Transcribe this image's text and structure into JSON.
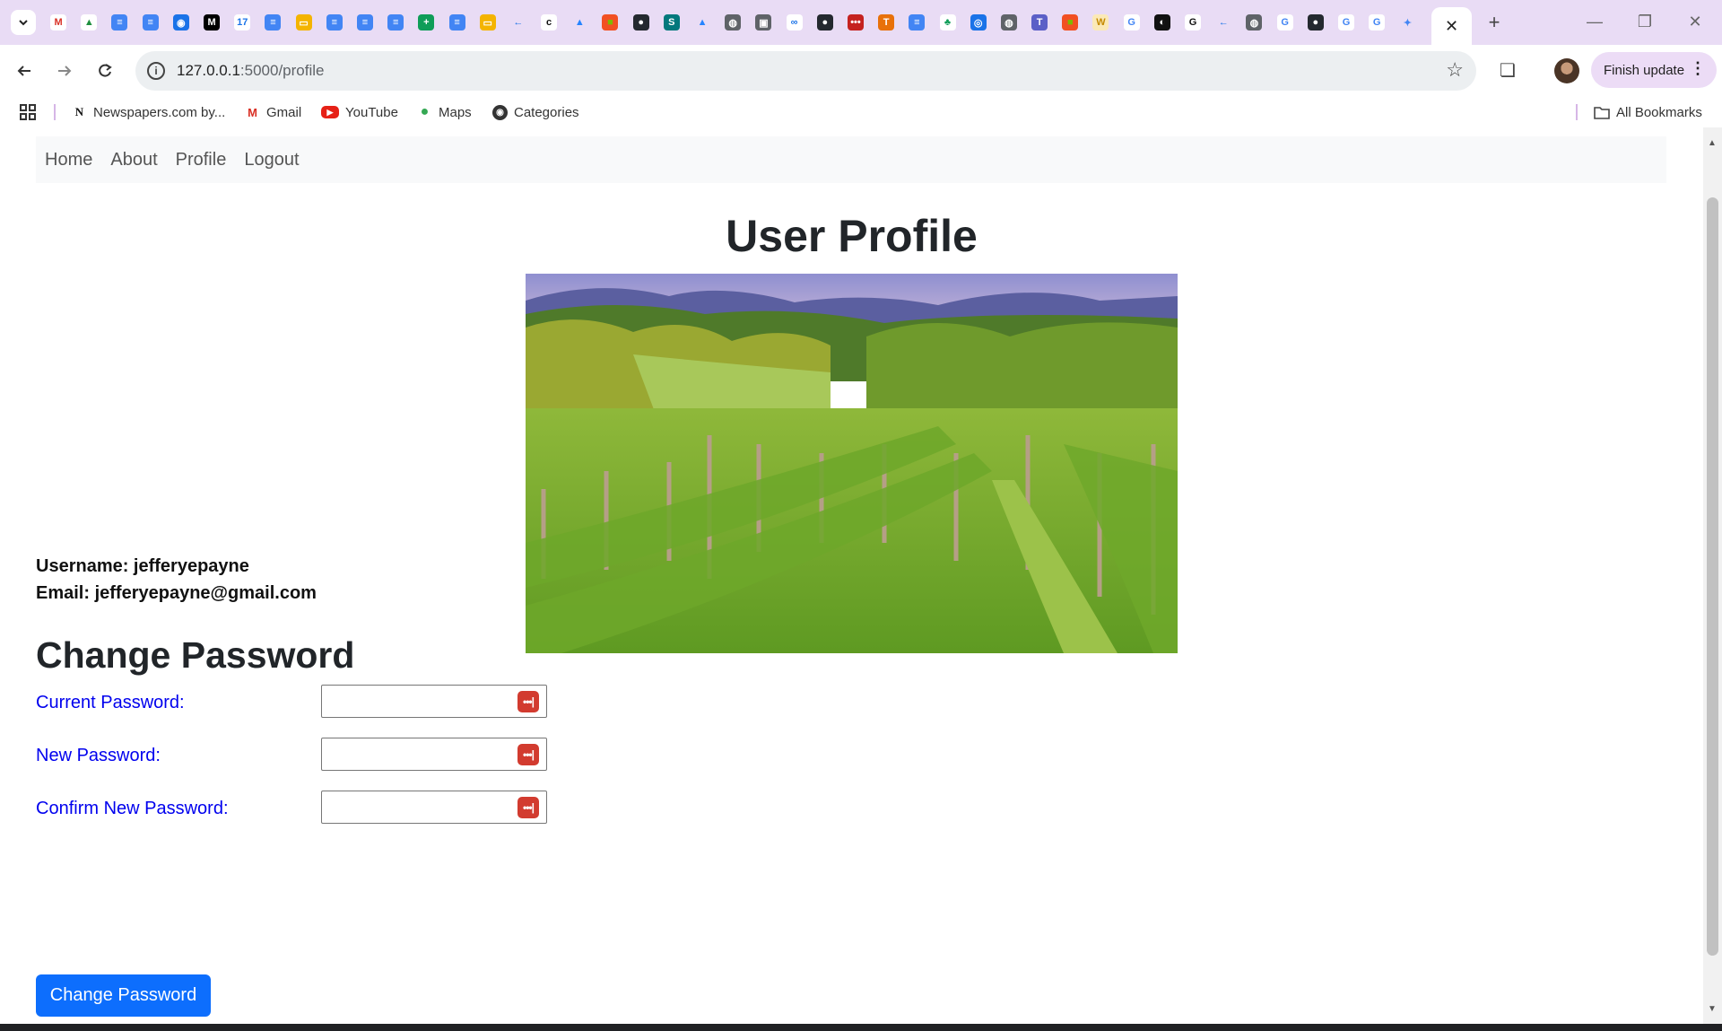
{
  "browser": {
    "tabs_icons": [
      "gmail-icon",
      "drive-icon",
      "docs-icon",
      "docs-icon",
      "chat-icon",
      "medium-icon",
      "calendar-icon",
      "docs-icon",
      "slides-icon",
      "docs-icon",
      "docs-icon",
      "docs-icon",
      "sheets-icon",
      "docs-icon",
      "slides-icon",
      "arrow-icon",
      "c-icon",
      "atlassian-icon",
      "microsoft-icon",
      "github-icon",
      "sharepoint-icon",
      "atlassian-icon",
      "globe-icon",
      "media-icon",
      "dots-icon",
      "github-icon",
      "red-icon",
      "t-icon",
      "docs-icon",
      "tree-icon",
      "eye-icon",
      "globe-icon",
      "teams-icon",
      "microsoft-icon",
      "w-icon",
      "google-icon",
      "flag-icon",
      "g-icon",
      "arrow-icon",
      "globe-icon",
      "google-icon",
      "github-icon",
      "google-icon",
      "google-icon",
      "gemini-icon"
    ],
    "active_tab_close": "✕",
    "new_tab": "+",
    "url_host": "127.0.0.1",
    "url_path": ":5000/profile",
    "finish_update": "Finish update"
  },
  "bookmarks": [
    {
      "label": "Newspapers.com by...",
      "icon": "newspapers-icon"
    },
    {
      "label": "Gmail",
      "icon": "gmail-icon"
    },
    {
      "label": "YouTube",
      "icon": "youtube-icon"
    },
    {
      "label": "Maps",
      "icon": "maps-icon"
    },
    {
      "label": "Categories",
      "icon": "globe-icon"
    }
  ],
  "all_bookmarks": "All Bookmarks",
  "nav": {
    "home": "Home",
    "about": "About",
    "profile": "Profile",
    "logout": "Logout"
  },
  "page": {
    "title": "User Profile",
    "username_line": "Username: jefferyepayne",
    "email_line": "Email: jefferyepayne@gmail.com",
    "change_title": "Change Password",
    "current_label": "Current Password:",
    "new_label": "New Password:",
    "confirm_label": "Confirm New Password:",
    "current_value": "",
    "new_value": "",
    "confirm_value": "",
    "submit_label": "Change Password"
  },
  "colors": {
    "tabstrip": "#e9dcf5",
    "link_label": "#0000ee",
    "primary_button": "#0d6efd",
    "password_manager": "#d23b2f"
  }
}
